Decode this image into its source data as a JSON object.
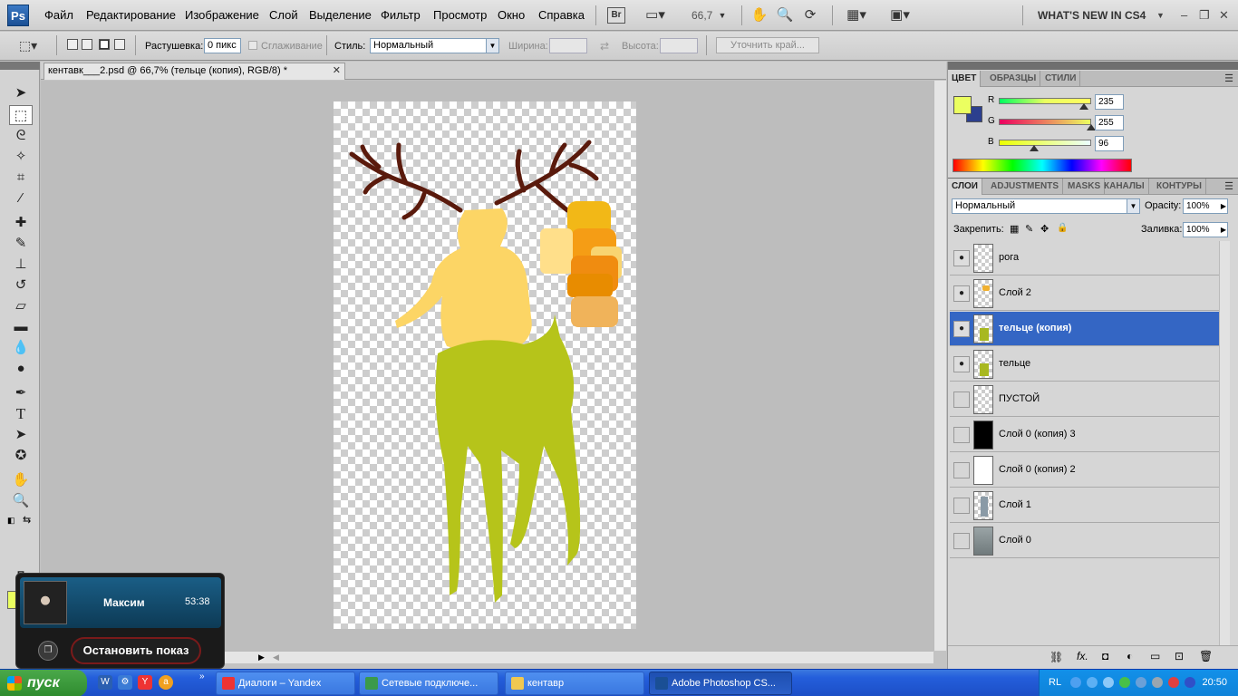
{
  "app": {
    "logo": "Ps"
  },
  "menu": [
    "Файл",
    "Редактирование",
    "Изображение",
    "Слой",
    "Выделение",
    "Фильтр",
    "Просмотр",
    "Окно",
    "Справка"
  ],
  "toolbar_top": {
    "br_label": "Br",
    "zoom": "66,7",
    "whats_new": "WHAT'S NEW IN CS4"
  },
  "options": {
    "feather_label": "Растушевка:",
    "feather_value": "0 пикс",
    "antialias_label": "Сглаживание",
    "style_label": "Стиль:",
    "style_value": "Нормальный",
    "width_label": "Ширина:",
    "height_label": "Высота:",
    "refine_label": "Уточнить край..."
  },
  "document": {
    "tab_title": "кентавк___2.psd @ 66,7% (тельце (копия), RGB/8) *"
  },
  "color_panel": {
    "tabs": [
      "ЦВЕТ",
      "ОБРАЗЦЫ",
      "СТИЛИ"
    ],
    "channels": [
      {
        "label": "R",
        "value": "235",
        "fraction": 0.92
      },
      {
        "label": "G",
        "value": "255",
        "fraction": 1.0
      },
      {
        "label": "B",
        "value": "96",
        "fraction": 0.38
      }
    ],
    "fg_color": "#ebff60",
    "bg_color": "#2c3f8e"
  },
  "layers_panel": {
    "tabs": [
      "СЛОИ",
      "ADJUSTMENTS",
      "MASKS",
      "КАНАЛЫ",
      "КОНТУРЫ"
    ],
    "blend_mode": "Нормальный",
    "opacity_label": "Opacity:",
    "opacity_value": "100%",
    "lock_label": "Закрепить:",
    "fill_label": "Заливка:",
    "fill_value": "100%",
    "layers": [
      {
        "name": "рога",
        "visible": true,
        "selected": false,
        "thumb": "antlers"
      },
      {
        "name": "Слой 2",
        "visible": true,
        "selected": false,
        "thumb": "swatches"
      },
      {
        "name": "тельце (копия)",
        "visible": true,
        "selected": true,
        "thumb": "body"
      },
      {
        "name": "тельце",
        "visible": true,
        "selected": false,
        "thumb": "body"
      },
      {
        "name": "ПУСТОЙ",
        "visible": false,
        "selected": false,
        "thumb": "empty"
      },
      {
        "name": "Слой 0 (копия) 3",
        "visible": false,
        "selected": false,
        "thumb": "black"
      },
      {
        "name": "Слой 0 (копия) 2",
        "visible": false,
        "selected": false,
        "thumb": "white"
      },
      {
        "name": "Слой 1",
        "visible": false,
        "selected": false,
        "thumb": "sketch"
      },
      {
        "name": "Слой 0",
        "visible": false,
        "selected": false,
        "thumb": "photo"
      }
    ]
  },
  "popup": {
    "name": "Максим",
    "time": "53:38",
    "button": "Остановить показ"
  },
  "taskbar": {
    "start": "пуск",
    "tasks": [
      {
        "label": "Диалоги – Yandex",
        "active": false
      },
      {
        "label": "Сетевые подключе...",
        "active": false
      },
      {
        "label": "кентавр",
        "active": false
      },
      {
        "label": "Adobe Photoshop CS...",
        "active": true
      }
    ],
    "lang": "RL",
    "clock": "20:50"
  }
}
